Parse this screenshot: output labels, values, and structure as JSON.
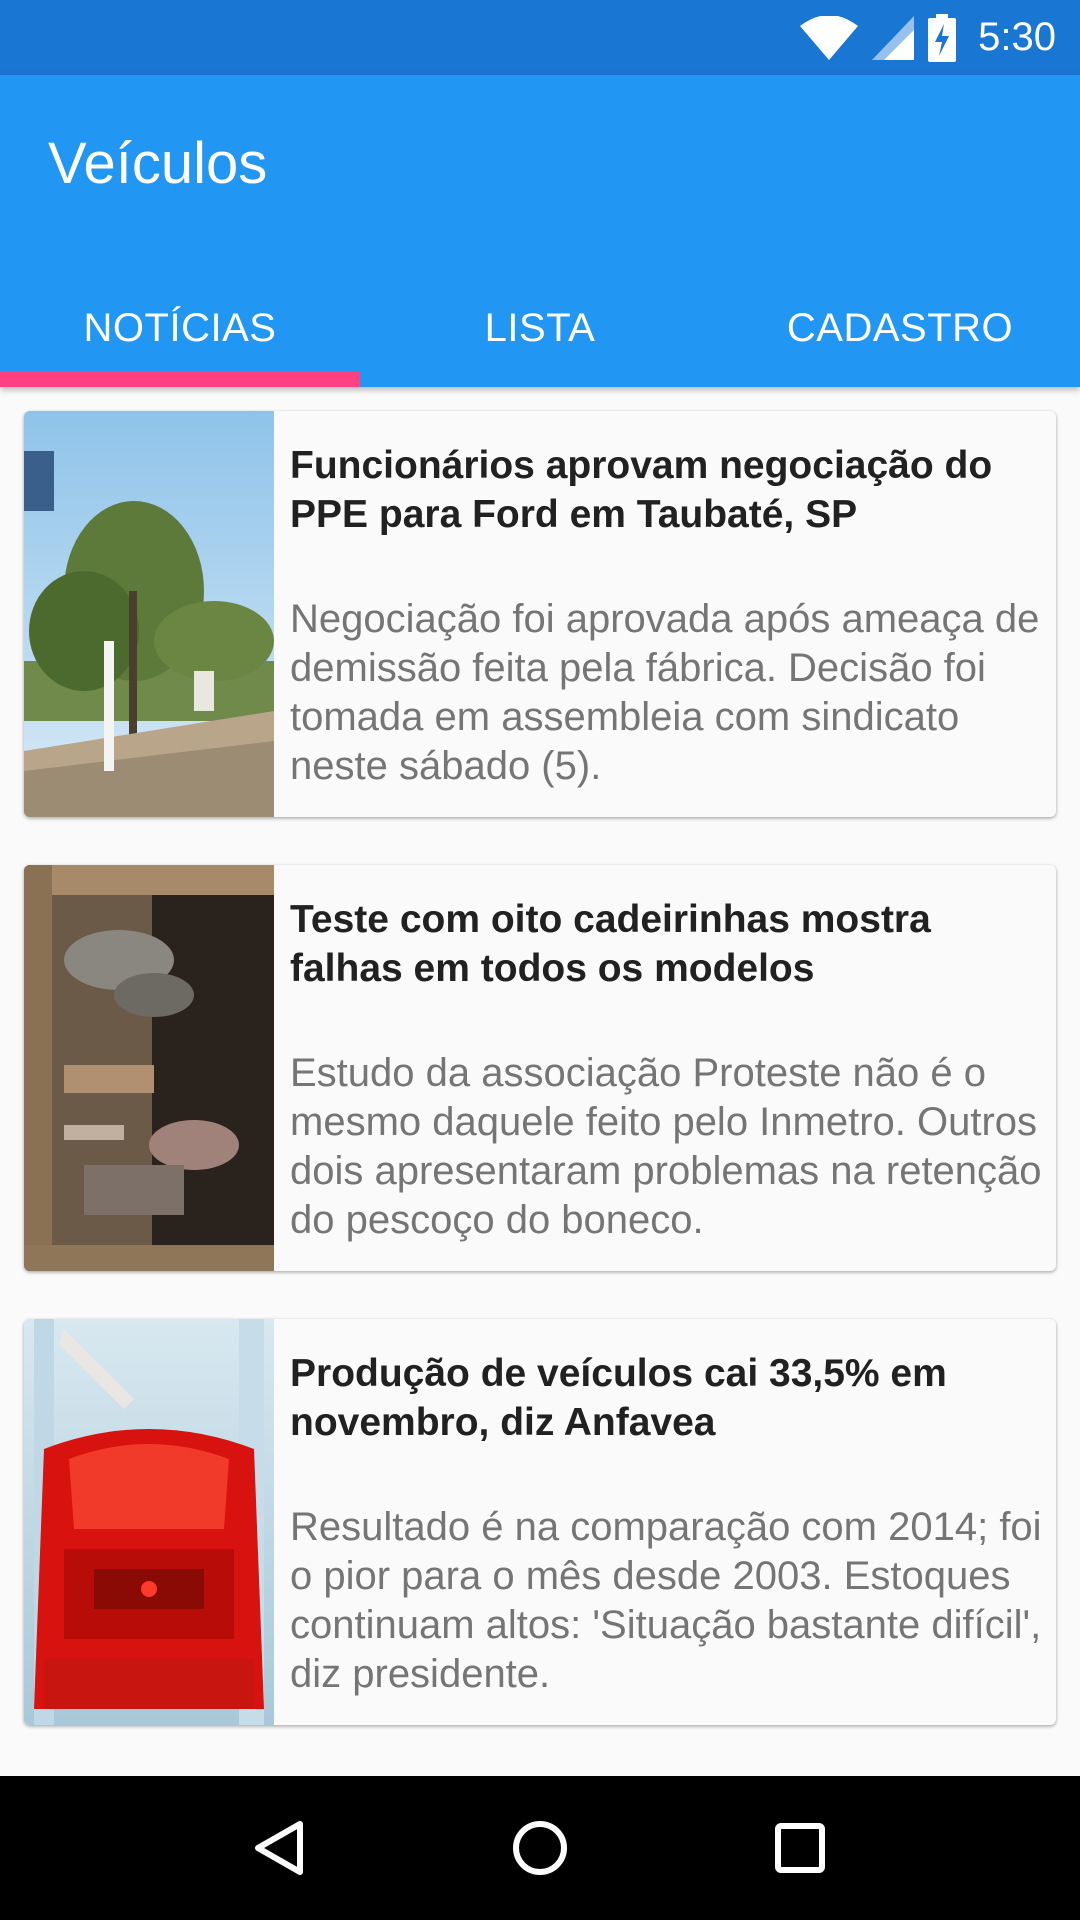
{
  "status_bar": {
    "time": "5:30",
    "icons": [
      "wifi-icon",
      "cell-signal-icon",
      "battery-charging-icon"
    ]
  },
  "app_bar": {
    "title": "Veículos",
    "tabs": [
      {
        "label": "NOTÍCIAS",
        "selected": true
      },
      {
        "label": "LISTA",
        "selected": false
      },
      {
        "label": "CADASTRO",
        "selected": false
      }
    ]
  },
  "news": [
    {
      "title": "Funcionários aprovam negociação do PPE para Ford em Taubaté, SP",
      "description": "Negociação foi aprovada após ameaça de demissão feita pela fábrica. Decisão foi tomada em assembleia com sindicato neste sábado (5)."
    },
    {
      "title": "Teste com oito cadeirinhas mostra falhas em todos os modelos",
      "description": "Estudo da associação Proteste não é o mesmo daquele feito pelo Inmetro. Outros dois apresentaram problemas na retenção do pescoço do boneco."
    },
    {
      "title": "Produção de veículos cai 33,5% em novembro, diz Anfavea",
      "description": "Resultado é na comparação com 2014; foi o pior para o mês desde 2003. Estoques continuam altos: 'Situação bastante difícil', diz presidente."
    }
  ],
  "nav_bar": {
    "buttons": [
      "back-icon",
      "home-icon",
      "recents-icon"
    ]
  },
  "colors": {
    "status_bar": "#1976d2",
    "app_bar": "#2196f3",
    "tab_indicator": "#ff4081"
  }
}
